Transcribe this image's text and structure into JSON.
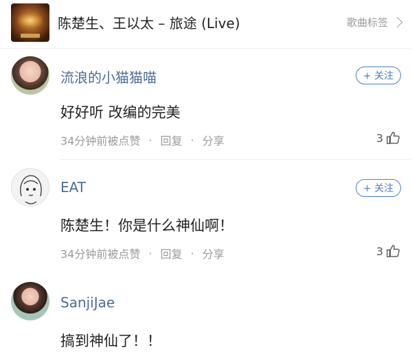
{
  "header": {
    "song_title": "陈楚生、王以太 – 旅途 (Live)",
    "tag_link_label": "歌曲标签"
  },
  "comments": [
    {
      "username": "流浪的小猫猫喵",
      "follow_label": "+ 关注",
      "text": "好好听 改编的完美",
      "time": "34分钟前被点赞",
      "reply_label": "回复",
      "share_label": "分享",
      "like_count": "3"
    },
    {
      "username": "EAT",
      "follow_label": "+ 关注",
      "text": "陈楚生！你是什么神仙啊！",
      "time": "34分钟前被点赞",
      "reply_label": "回复",
      "share_label": "分享",
      "like_count": "3"
    },
    {
      "username": "SanjiJae",
      "text": "搞到神仙了！！"
    }
  ],
  "colors": {
    "username": "#4a6e9a",
    "follow_border": "#4a7fc1",
    "meta_text": "#9a9a9a"
  }
}
